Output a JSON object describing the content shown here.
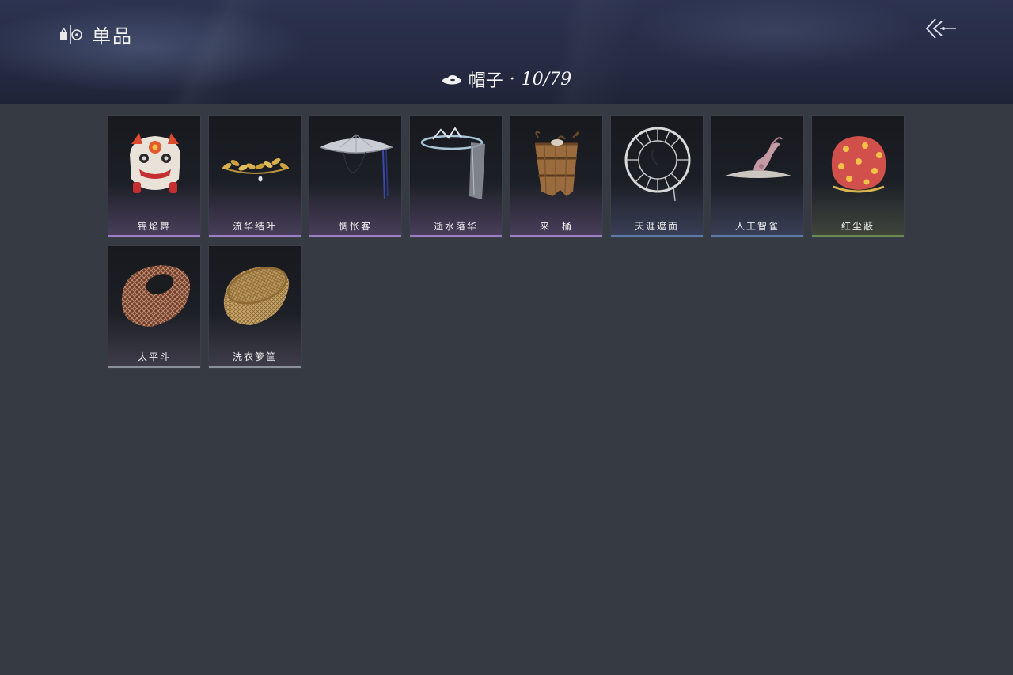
{
  "header": {
    "title": "单品",
    "title_icon": "wardrobe-icon",
    "back_icon": "double-chevron-left-icon"
  },
  "category": {
    "icon": "hat-icon",
    "label": "帽子",
    "separator": "·",
    "count": "10/79"
  },
  "items": [
    {
      "name": "锦焰舞",
      "icon": "lion-dance-head-icon",
      "rarity_color": "#9b7fc4"
    },
    {
      "name": "流华结叶",
      "icon": "golden-leaf-wreath-icon",
      "rarity_color": "#9b7fc4"
    },
    {
      "name": "惆怅客",
      "icon": "bamboo-hat-icon",
      "rarity_color": "#9b7fc4"
    },
    {
      "name": "逝水落华",
      "icon": "veiled-hat-icon",
      "rarity_color": "#9b7fc4"
    },
    {
      "name": "来一桶",
      "icon": "wooden-bucket-icon",
      "rarity_color": "#9b7fc4"
    },
    {
      "name": "天涯遮面",
      "icon": "hoop-frame-hat-icon",
      "rarity_color": "#5d79a8"
    },
    {
      "name": "人工智雀",
      "icon": "bird-hat-icon",
      "rarity_color": "#5d79a8"
    },
    {
      "name": "红尘蔽",
      "icon": "red-hood-icon",
      "rarity_color": "#6f8a4e"
    },
    {
      "name": "太平斗",
      "icon": "woven-basket-hat-icon",
      "rarity_color": "#8a8f99"
    },
    {
      "name": "洗衣箩筐",
      "icon": "laundry-basket-icon",
      "rarity_color": "#8a8f99"
    }
  ]
}
